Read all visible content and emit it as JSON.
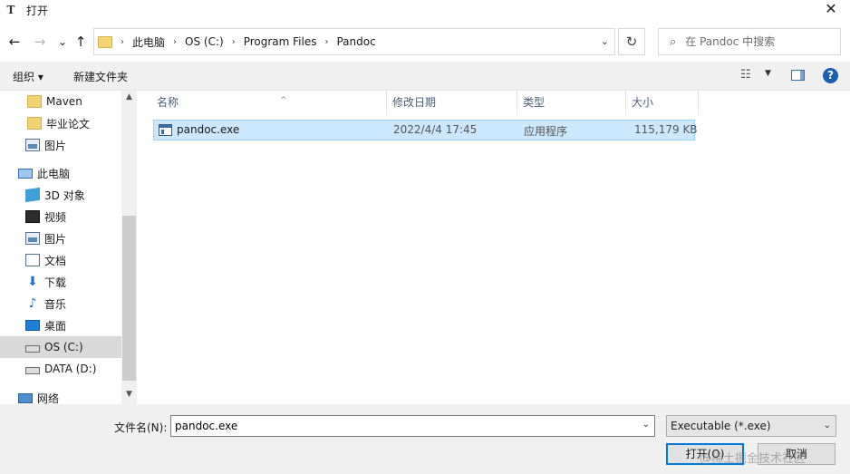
{
  "window": {
    "title": "打开",
    "app_icon_glyph": "T",
    "close_glyph": "✕"
  },
  "nav": {
    "back_glyph": "←",
    "forward_glyph": "→",
    "recent_glyph": "⌄",
    "up_glyph": "↑",
    "breadcrumb": [
      "此电脑",
      "OS (C:)",
      "Program Files",
      "Pandoc"
    ],
    "crumb_sep": "›",
    "addr_drop_glyph": "⌄",
    "refresh_glyph": "↻",
    "search_placeholder": "在 Pandoc 中搜索",
    "search_glyph": "⌕"
  },
  "toolbar": {
    "organize_label": "组织 ▾",
    "new_folder_label": "新建文件夹",
    "view_glyph": "☷",
    "view_drop_glyph": "▼",
    "help_glyph": "?"
  },
  "sidebar": {
    "items": [
      {
        "label": "Maven",
        "icon": "folder-icon"
      },
      {
        "label": "毕业论文",
        "icon": "folder-icon"
      },
      {
        "label": "图片",
        "icon": "pictures-icon"
      },
      {
        "label": "此电脑",
        "icon": "this-pc-icon"
      },
      {
        "label": "3D 对象",
        "icon": "3d-objects-icon"
      },
      {
        "label": "视频",
        "icon": "videos-icon"
      },
      {
        "label": "图片",
        "icon": "pictures-icon"
      },
      {
        "label": "文档",
        "icon": "documents-icon"
      },
      {
        "label": "下载",
        "icon": "downloads-icon"
      },
      {
        "label": "音乐",
        "icon": "music-icon"
      },
      {
        "label": "桌面",
        "icon": "desktop-icon"
      },
      {
        "label": "OS (C:)",
        "icon": "drive-icon"
      },
      {
        "label": "DATA (D:)",
        "icon": "drive-icon"
      },
      {
        "label": "网络",
        "icon": "network-icon"
      }
    ],
    "download_glyph": "⬇",
    "music_glyph": "♪",
    "scroll_up_glyph": "▲",
    "scroll_down_glyph": "▼"
  },
  "filelist": {
    "columns": [
      "名称",
      "修改日期",
      "类型",
      "大小"
    ],
    "sort_glyph": "^",
    "rows": [
      {
        "name": "pandoc.exe",
        "modified": "2022/4/4 17:45",
        "type": "应用程序",
        "size": "115,179 KB"
      }
    ]
  },
  "bottom": {
    "filename_label": "文件名(N):",
    "filename_value": "pandoc.exe",
    "filename_drop_glyph": "⌄",
    "filetype_value": "Executable (*.exe)",
    "filetype_drop_glyph": "⌄",
    "open_label": "打开(O)",
    "cancel_label": "取消",
    "watermark": "@稀土掘金技术社区"
  },
  "colors": {
    "accent": "#0078d7",
    "selection_bg": "#cce8ff",
    "selection_border": "#99d1ff"
  }
}
